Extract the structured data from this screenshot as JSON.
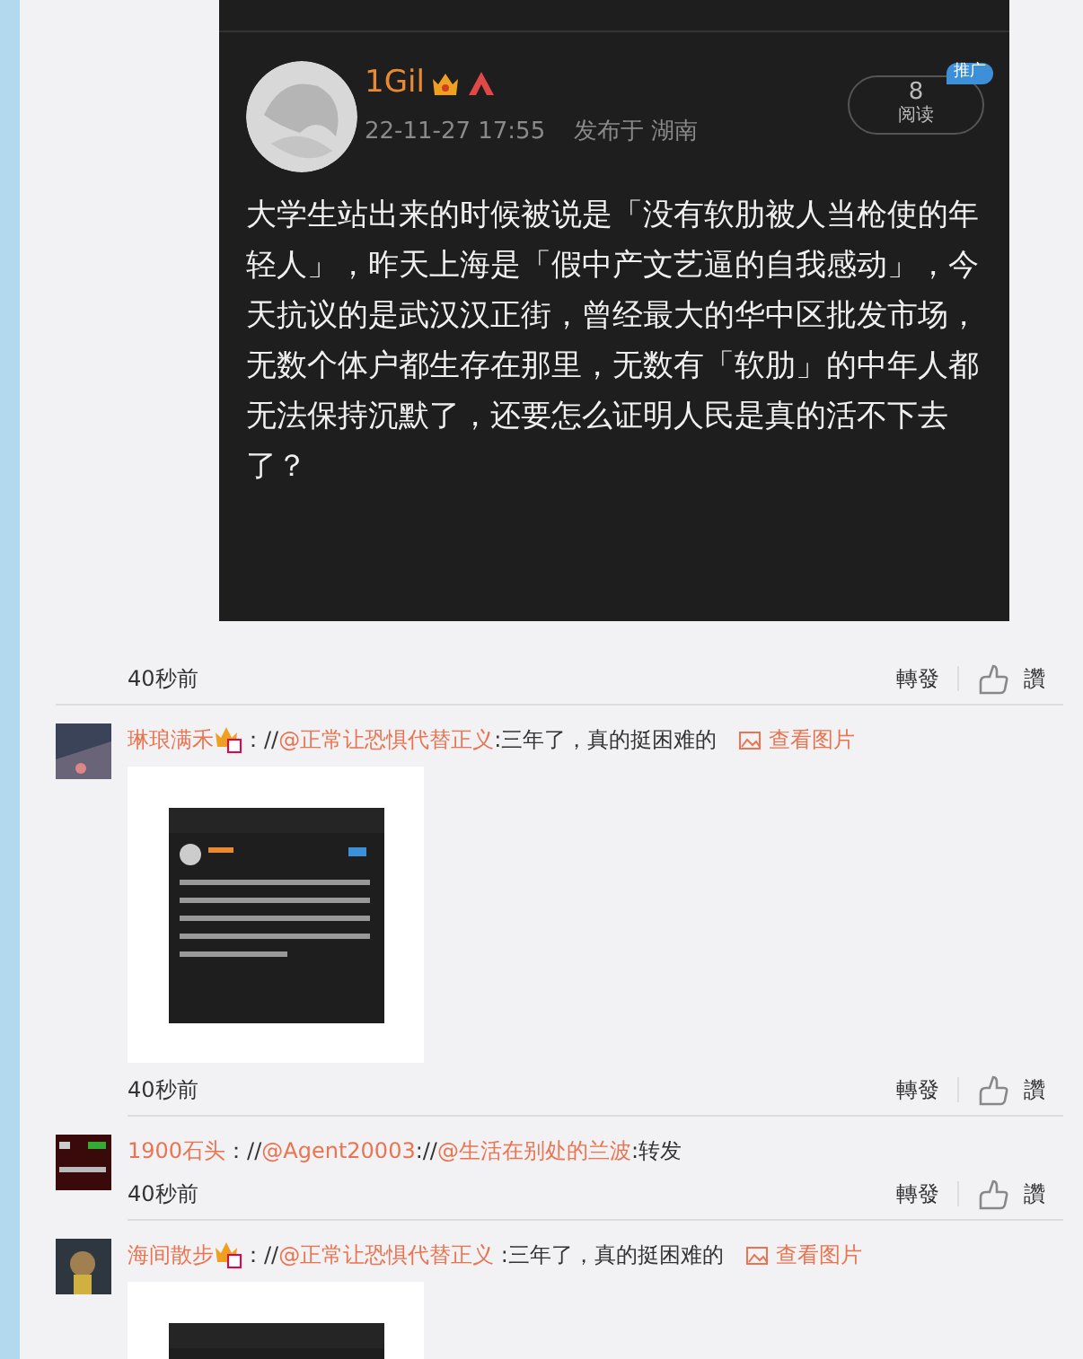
{
  "embedded_post": {
    "author": "1Gil",
    "time": "22-11-27 17:55",
    "location_text": "发布于 湖南",
    "views": "8",
    "views_label": "阅读",
    "promo_badge": "推广",
    "text": "大学生站出来的时候被说是「没有软肋被人当枪使的年轻人」，昨天上海是「假中产文艺逼的自我感动」，今天抗议的是武汉汉正街，曾经最大的华中区批发市场，无数个体户都生存在那里，无数有「软肋」的中年人都无法保持沉默了，还要怎么证明人民是真的活不下去了？"
  },
  "post_footer": {
    "time": "40秒前",
    "repost": "轉發",
    "like": "讚"
  },
  "comments": [
    {
      "user": "琳琅满禾",
      "badge": true,
      "segments": [
        {
          "kind": "text",
          "text": "：//"
        },
        {
          "kind": "mention",
          "text": "@正常让恐惧代替正义"
        },
        {
          "kind": "text",
          "text": ":三年了，真的挺困难的"
        }
      ],
      "view_image": "查看图片",
      "time": "40秒前",
      "repost": "轉發",
      "like": "讚"
    },
    {
      "user": "1900石头",
      "badge": false,
      "segments": [
        {
          "kind": "text",
          "text": "：//"
        },
        {
          "kind": "mention",
          "text": "@Agent20003"
        },
        {
          "kind": "text",
          "text": "://"
        },
        {
          "kind": "mention",
          "text": "@生活在别处的兰波"
        },
        {
          "kind": "text",
          "text": ":转发"
        }
      ],
      "time": "40秒前",
      "repost": "轉發",
      "like": "讚"
    },
    {
      "user": "海间散步",
      "badge": true,
      "segments": [
        {
          "kind": "text",
          "text": "：//"
        },
        {
          "kind": "mention",
          "text": "@正常让恐惧代替正义"
        },
        {
          "kind": "text",
          "text": " :三年了，真的挺困难的"
        }
      ],
      "view_image": "查看图片"
    }
  ]
}
